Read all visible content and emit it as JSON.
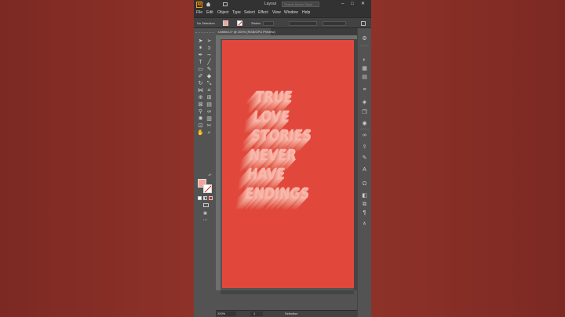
{
  "app": {
    "logo": "Ai",
    "workspace": "Layout",
    "search_placeholder": "Search Adobe Stock",
    "window_controls": [
      "–",
      "□",
      "✕"
    ]
  },
  "menu": [
    "File",
    "Edit",
    "Object",
    "Type",
    "Select",
    "Effect",
    "View",
    "Window",
    "Help"
  ],
  "control_bar": {
    "selection": "No Selection",
    "stroke_label": "Stroke:",
    "fill_color": "#f4a497"
  },
  "document": {
    "tab_title": "Untitled-1* @ 200% (RGB/GPU Preview)",
    "artboard_color": "#e2473b"
  },
  "artwork": {
    "lines": [
      "TRUE",
      "LOVE",
      "STORIES",
      "NEVER",
      "HAVE",
      "ENDINGS"
    ],
    "text_color": "#f8b7ab"
  },
  "status": {
    "zoom": "200%",
    "page": "1",
    "tool": "Selection"
  }
}
